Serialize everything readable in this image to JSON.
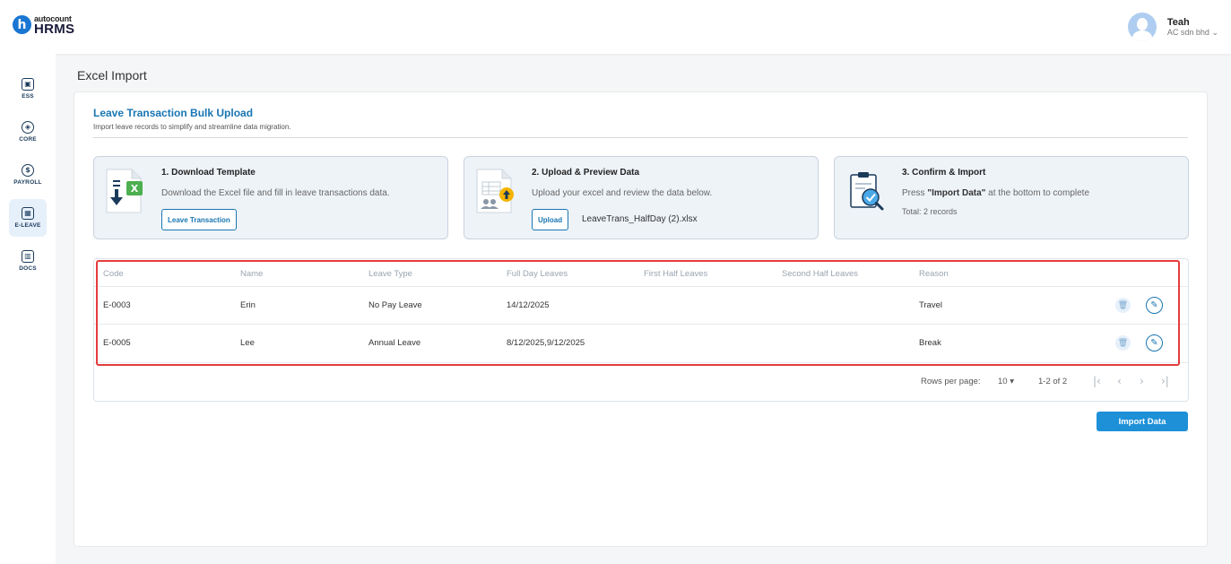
{
  "header": {
    "logo_top": "autocount",
    "logo_bottom": "HRMS",
    "user_name": "Teah",
    "user_company": "AC sdn bhd"
  },
  "sidebar": {
    "items": [
      {
        "label": "ESS",
        "icon": "id-badge-icon"
      },
      {
        "label": "CORE",
        "icon": "cube-icon"
      },
      {
        "label": "PAYROLL",
        "icon": "dollar-icon"
      },
      {
        "label": "E-LEAVE",
        "icon": "calendar-icon",
        "active": true
      },
      {
        "label": "DOCS",
        "icon": "document-chart-icon"
      }
    ]
  },
  "page": {
    "title": "Excel Import",
    "section_title": "Leave Transaction Bulk Upload",
    "section_subtitle": "Import leave records to simplify and streamline data migration."
  },
  "steps": {
    "download": {
      "title": "1. Download Template",
      "desc": "Download the Excel file and fill in leave transactions data.",
      "button": "Leave Transaction"
    },
    "upload": {
      "title": "2. Upload & Preview Data",
      "desc": "Upload your excel and review the data below.",
      "button": "Upload",
      "file_name": "LeaveTrans_HalfDay (2).xlsx"
    },
    "confirm": {
      "title": "3. Confirm & Import",
      "desc_prefix": "Press ",
      "desc_bold": "\"Import Data\"",
      "desc_suffix": " at the bottom to complete",
      "total": "Total: 2 records"
    }
  },
  "table": {
    "headers": [
      "Code",
      "Name",
      "Leave Type",
      "Full Day Leaves",
      "First Half Leaves",
      "Second Half Leaves",
      "Reason"
    ],
    "rows": [
      {
        "code": "E-0003",
        "name": "Erin",
        "leave_type": "No Pay Leave",
        "full_day": "14/12/2025",
        "first_half": "",
        "second_half": "",
        "reason": "Travel"
      },
      {
        "code": "E-0005",
        "name": "Lee",
        "leave_type": "Annual Leave",
        "full_day": "8/12/2025,9/12/2025",
        "first_half": "",
        "second_half": "",
        "reason": "Break"
      }
    ],
    "rows_per_page_label": "Rows per page:",
    "rows_per_page_value": "10",
    "range": "1-2 of 2"
  },
  "actions": {
    "import_label": "Import Data"
  },
  "colors": {
    "primary": "#1976b2",
    "import_button": "#1e90d8",
    "highlight_outline": "#e53b3b"
  }
}
